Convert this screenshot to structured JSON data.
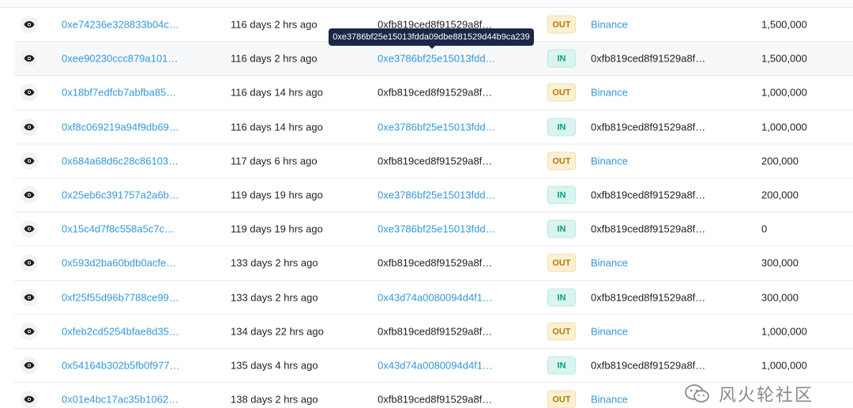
{
  "tooltip": {
    "text": "0xe3786bf25e15013fdda09dbe881529d44b9ca239"
  },
  "watermark": {
    "text": "风火轮社区"
  },
  "colors": {
    "link": "#3498db",
    "out_badge_bg": "#fbefd5",
    "out_badge_fg": "#b47d00",
    "in_badge_bg": "#daf4ef",
    "in_badge_fg": "#00a186",
    "tooltip_bg": "#1a2746"
  },
  "rows": [
    {
      "hash": "0xe74236e328833b04c…",
      "age": "116 days 2 hrs ago",
      "from": "0xfb819ced8f91529a8f…",
      "from_link": false,
      "dir": "OUT",
      "to": "Binance",
      "to_link": true,
      "value": "1,500,000"
    },
    {
      "hash": "0xee90230ccc879a101…",
      "age": "116 days 2 hrs ago",
      "from": "0xe3786bf25e15013fdd…",
      "from_link": true,
      "dir": "IN",
      "to": "0xfb819ced8f91529a8f…",
      "to_link": false,
      "value": "1,500,000"
    },
    {
      "hash": "0x18bf7edfcb7abfba85…",
      "age": "116 days 14 hrs ago",
      "from": "0xfb819ced8f91529a8f…",
      "from_link": false,
      "dir": "OUT",
      "to": "Binance",
      "to_link": true,
      "value": "1,000,000"
    },
    {
      "hash": "0xf8c069219a94f9db69…",
      "age": "116 days 14 hrs ago",
      "from": "0xe3786bf25e15013fdd…",
      "from_link": true,
      "dir": "IN",
      "to": "0xfb819ced8f91529a8f…",
      "to_link": false,
      "value": "1,000,000"
    },
    {
      "hash": "0x684a68d6c28c86103…",
      "age": "117 days 6 hrs ago",
      "from": "0xfb819ced8f91529a8f…",
      "from_link": false,
      "dir": "OUT",
      "to": "Binance",
      "to_link": true,
      "value": "200,000"
    },
    {
      "hash": "0x25eb6c391757a2a6b…",
      "age": "119 days 19 hrs ago",
      "from": "0xe3786bf25e15013fdd…",
      "from_link": true,
      "dir": "IN",
      "to": "0xfb819ced8f91529a8f…",
      "to_link": false,
      "value": "200,000"
    },
    {
      "hash": "0x15c4d7f8c558a5c7c…",
      "age": "119 days 19 hrs ago",
      "from": "0xe3786bf25e15013fdd…",
      "from_link": true,
      "dir": "IN",
      "to": "0xfb819ced8f91529a8f…",
      "to_link": false,
      "value": "0"
    },
    {
      "hash": "0x593d2ba60bdb0acfe…",
      "age": "133 days 2 hrs ago",
      "from": "0xfb819ced8f91529a8f…",
      "from_link": false,
      "dir": "OUT",
      "to": "Binance",
      "to_link": true,
      "value": "300,000"
    },
    {
      "hash": "0xf25f55d96b7788ce99…",
      "age": "133 days 2 hrs ago",
      "from": "0x43d74a0080094d4f1…",
      "from_link": true,
      "dir": "IN",
      "to": "0xfb819ced8f91529a8f…",
      "to_link": false,
      "value": "300,000"
    },
    {
      "hash": "0xfeb2cd5254bfae8d35…",
      "age": "134 days 22 hrs ago",
      "from": "0xfb819ced8f91529a8f…",
      "from_link": false,
      "dir": "OUT",
      "to": "Binance",
      "to_link": true,
      "value": "1,000,000"
    },
    {
      "hash": "0x54164b302b5fb0f977…",
      "age": "135 days 4 hrs ago",
      "from": "0x43d74a0080094d4f1…",
      "from_link": true,
      "dir": "IN",
      "to": "0xfb819ced8f91529a8f…",
      "to_link": false,
      "value": "1,000,000"
    },
    {
      "hash": "0x01e4bc17ac35b1062…",
      "age": "138 days 2 hrs ago",
      "from": "0xfb819ced8f91529a8f…",
      "from_link": false,
      "dir": "OUT",
      "to": "Binance",
      "to_link": true,
      "value": ""
    }
  ]
}
